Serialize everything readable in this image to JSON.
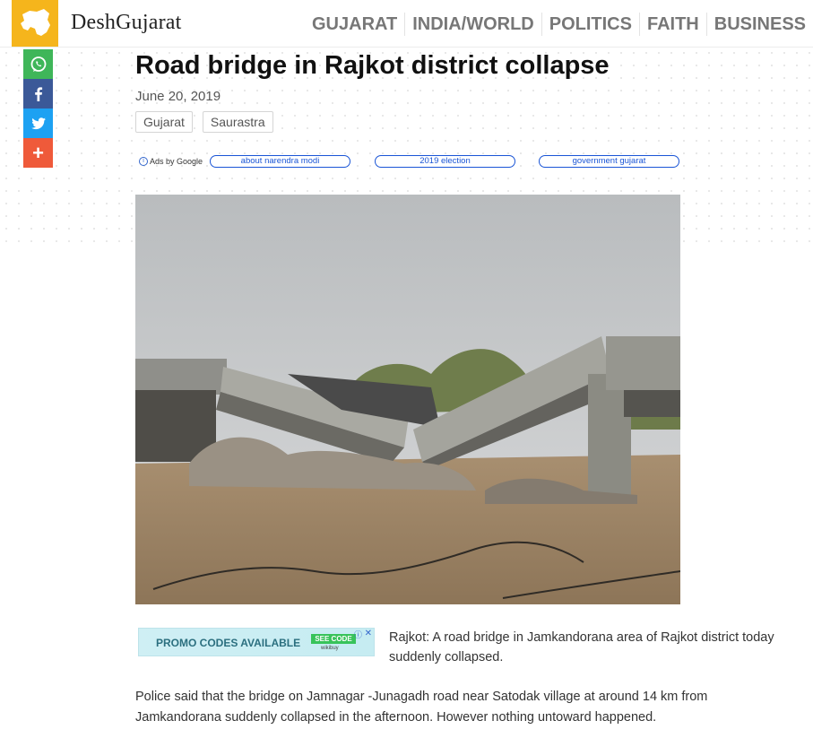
{
  "header": {
    "brand": "DeshGujarat",
    "nav": [
      "GUJARAT",
      "INDIA/WORLD",
      "POLITICS",
      "FAITH",
      "BUSINESS"
    ]
  },
  "share": {
    "items": [
      "whatsapp-icon",
      "facebook-icon",
      "twitter-icon",
      "plus-icon"
    ],
    "colors": [
      "#3fb659",
      "#3b5998",
      "#1da1f2",
      "#ef5a3a"
    ],
    "more_label": "+"
  },
  "article": {
    "title": "Road bridge in Rajkot district collapse",
    "date": "June 20, 2019",
    "tags": [
      "Gujarat",
      "Saurastra"
    ],
    "paragraph1": "Rajkot: A road bridge in Jamkandorana area of Rajkot district today suddenly collapsed.",
    "paragraph2": "Police said that the bridge on Jamnagar -Junagadh road near Satodak village at around 14 km from Jamkandorana suddenly collapsed in the afternoon. However nothing untoward happened."
  },
  "ads": {
    "label": "Ads by Google",
    "links": [
      "about narendra modi",
      "2019 election",
      "government gujarat"
    ]
  },
  "promo": {
    "text": "PROMO CODES AVAILABLE",
    "button": "SEE CODE",
    "brand": "wikibuy"
  }
}
